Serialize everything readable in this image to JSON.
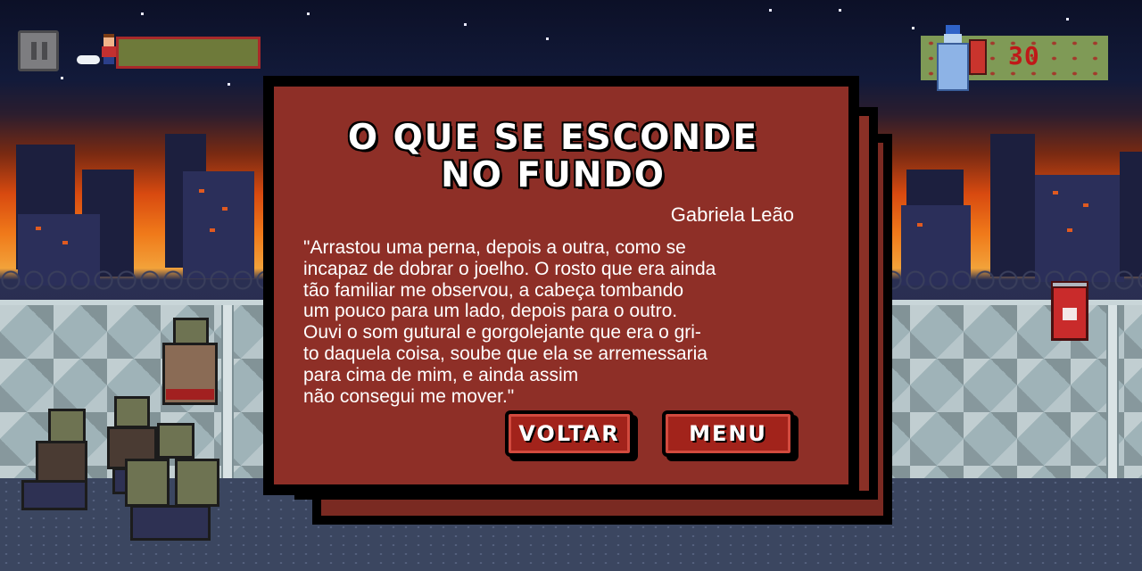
{
  "hud": {
    "ammo_count": "30",
    "health_bar_color": "#6e7a3a",
    "accent_red": "#a82a2a"
  },
  "icons": {
    "pause": "pause-icon",
    "player": "player-avatar-icon",
    "ammo": "water-bottle-icon",
    "pickup": "soda-can-icon"
  },
  "dialog": {
    "title": "O QUE SE ESCONDE\nNO FUNDO",
    "author": "Gabriela Leão",
    "quote": "\"Arrastou uma perna, depois a outra, como se\nincapaz de dobrar o joelho. O rosto que era ainda\ntão familiar me observou, a cabeça tombando\num pouco para um lado, depois para o outro.\nOuvi o som gutural e gorgolejante que era o gri-\nto daquela coisa, soube que ela se arremessaria\npara cima de mim, e ainda assim\nnão consegui me mover.\"",
    "back_label": "VOLTAR",
    "menu_label": "MENU",
    "panel_color": "#8e2f27"
  }
}
